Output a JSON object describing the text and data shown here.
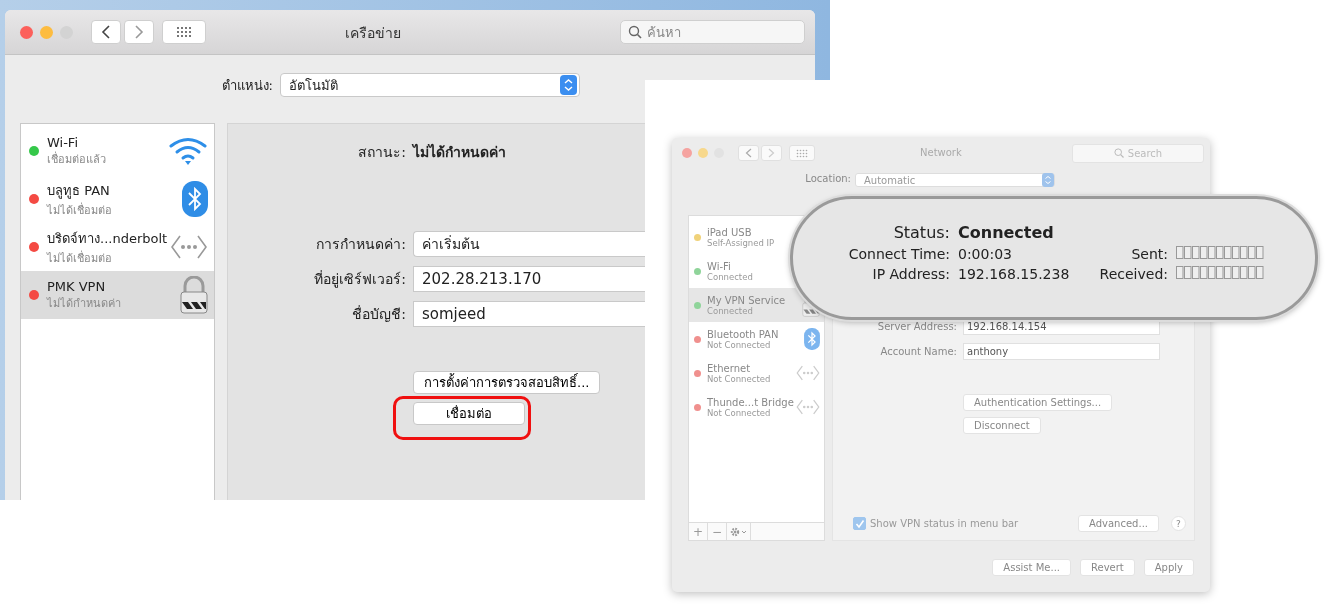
{
  "thai_window": {
    "title": "เครือข่าย",
    "search": {
      "placeholder": "ค้นหา"
    },
    "location": {
      "label": "ตำแหน่ง:",
      "value": "อัตโนมัติ"
    },
    "services": [
      {
        "name": "Wi-Fi",
        "status": "เชื่อมต่อแล้ว",
        "color": "#35c84a",
        "kind": "wifi",
        "selected": false
      },
      {
        "name": "บลูทูธ PAN",
        "status": "ไม่ได้เชื่อมต่อ",
        "color": "#f44a43",
        "kind": "bluetooth",
        "selected": false
      },
      {
        "name": "บริดจ์ทาง...nderbolt",
        "status": "ไม่ได้เชื่อมต่อ",
        "color": "#f44a43",
        "kind": "ethernet",
        "selected": false
      },
      {
        "name": "PMK VPN",
        "status": "ไม่ได้กำหนดค่า",
        "color": "#f44a43",
        "kind": "vpn",
        "selected": true
      }
    ],
    "status": {
      "label": "สถานะ:",
      "value": "ไม่ได้กำหนดค่า"
    },
    "fields": [
      {
        "label": "การกำหนดค่า:",
        "value": "ค่าเริ่มต้น"
      },
      {
        "label": "ที่อยู่เซิร์ฟเวอร์:",
        "value": "202.28.213.170"
      },
      {
        "label": "ชื่อบัญชี:",
        "value": "somjeed"
      }
    ],
    "buttons": [
      {
        "label": "การตั้งค่าการตรวจสอบสิทธิ์...",
        "highlighted": false
      },
      {
        "label": "เชื่อมต่อ",
        "highlighted": true
      }
    ]
  },
  "english_window": {
    "title": "Network",
    "search": {
      "placeholder": "Search"
    },
    "location": {
      "label": "Location:",
      "value": "Automatic"
    },
    "services": [
      {
        "name": "iPad USB",
        "status": "Self-Assigned IP",
        "color": "#f0d27a",
        "kind": "none",
        "selected": false
      },
      {
        "name": "Wi-Fi",
        "status": "Connected",
        "color": "#8fd49a",
        "kind": "none",
        "selected": false
      },
      {
        "name": "My VPN Service",
        "status": "Connected",
        "color": "#8fd49a",
        "kind": "vpn",
        "selected": true
      },
      {
        "name": "Bluetooth PAN",
        "status": "Not Connected",
        "color": "#f0908e",
        "kind": "bluetooth",
        "selected": false
      },
      {
        "name": "Ethernet",
        "status": "Not Connected",
        "color": "#f0908e",
        "kind": "ethernet",
        "selected": false
      },
      {
        "name": "Thunde...t Bridge",
        "status": "Not Connected",
        "color": "#f0908e",
        "kind": "ethernet",
        "selected": false
      }
    ],
    "toolbar": [
      "+",
      "−"
    ],
    "fields": [
      {
        "label": "Server Address:",
        "value": "192.168.14.154"
      },
      {
        "label": "Account Name:",
        "value": "anthony"
      }
    ],
    "buttons": [
      "Authentication Settings...",
      "Disconnect"
    ],
    "show_status": {
      "label": "Show VPN status in menu bar",
      "checked": true
    },
    "advanced": "Advanced...",
    "help": "?",
    "footer_buttons": [
      "Assist Me...",
      "Revert",
      "Apply"
    ]
  },
  "callout": {
    "status": {
      "label": "Status:",
      "value": "Connected"
    },
    "rows": [
      {
        "label": "Connect Time:",
        "value": "0:00:03",
        "meter_label": "Sent:"
      },
      {
        "label": "IP Address:",
        "value": "192.168.15.238",
        "meter_label": "Received:"
      }
    ]
  }
}
